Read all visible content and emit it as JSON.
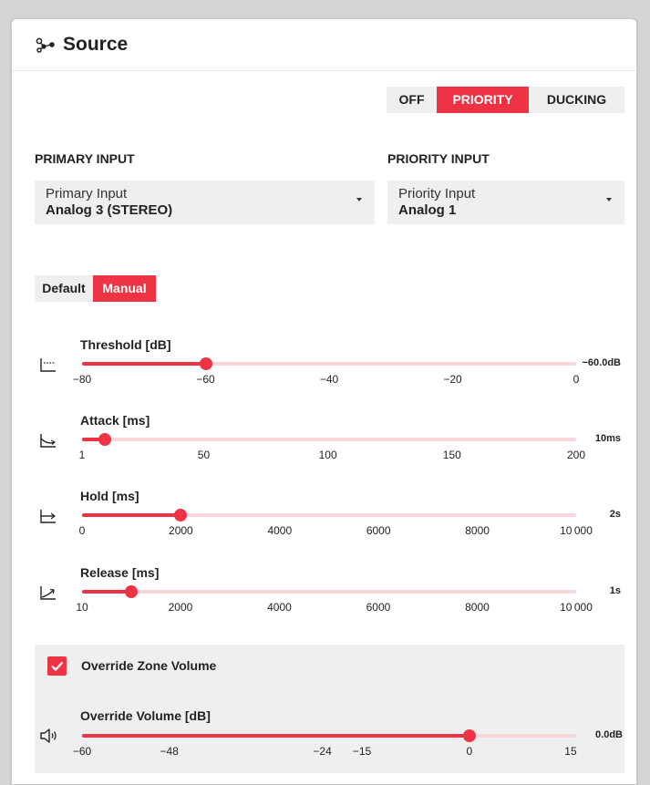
{
  "header": {
    "title": "Source",
    "icon": "nodes-icon"
  },
  "mode": {
    "options": [
      "OFF",
      "PRIORITY",
      "DUCKING"
    ],
    "selected": "PRIORITY"
  },
  "primary": {
    "section_label": "PRIMARY INPUT",
    "field_label": "Primary Input",
    "value": "Analog 3 (STEREO)"
  },
  "priority": {
    "section_label": "PRIORITY INPUT",
    "field_label": "Priority Input",
    "value": "Analog 1"
  },
  "preset": {
    "options": [
      "Default",
      "Manual"
    ],
    "selected": "Manual"
  },
  "sliders": [
    {
      "title": "Threshold [dB]",
      "icon": "threshold-icon",
      "value_text": "−60.0dB",
      "min": -80,
      "max": 0,
      "value": -60,
      "ticks": [
        "−80",
        "−60",
        "−40",
        "−20",
        "0"
      ],
      "tick_values": [
        -80,
        -60,
        -40,
        -20,
        0
      ]
    },
    {
      "title": "Attack [ms]",
      "icon": "attack-icon",
      "value_text": "10ms",
      "min": 1,
      "max": 200,
      "value": 10,
      "ticks": [
        "1",
        "50",
        "100",
        "150",
        "200"
      ],
      "tick_values": [
        1,
        50,
        100,
        150,
        200
      ]
    },
    {
      "title": "Hold [ms]",
      "icon": "hold-icon",
      "value_text": "2s",
      "min": 0,
      "max": 10000,
      "value": 2000,
      "ticks": [
        "0",
        "2000",
        "4000",
        "6000",
        "8000",
        "10 000"
      ],
      "tick_values": [
        0,
        2000,
        4000,
        6000,
        8000,
        10000
      ]
    },
    {
      "title": "Release [ms]",
      "icon": "release-icon",
      "value_text": "1s",
      "min": 10,
      "max": 10000,
      "value": 1000,
      "ticks": [
        "10",
        "2000",
        "4000",
        "6000",
        "8000",
        "10 000"
      ],
      "tick_values": [
        10,
        2000,
        4000,
        6000,
        8000,
        10000
      ]
    }
  ],
  "override": {
    "checkbox_label": "Override Zone Volume",
    "checked": true,
    "slider": {
      "title": "Override Volume [dB]",
      "icon": "speaker-icon",
      "value_text": "0.0dB",
      "value": 0,
      "ticks": [
        "−60",
        "−48",
        "−24",
        "−15",
        "0",
        "15"
      ],
      "tick_fractions": [
        0,
        0.1765,
        0.4863,
        0.5664,
        0.7839,
        0.9889
      ]
    }
  },
  "colors": {
    "accent": "#ee3344",
    "track": "#f8d6da",
    "control_bg": "#efefef"
  }
}
